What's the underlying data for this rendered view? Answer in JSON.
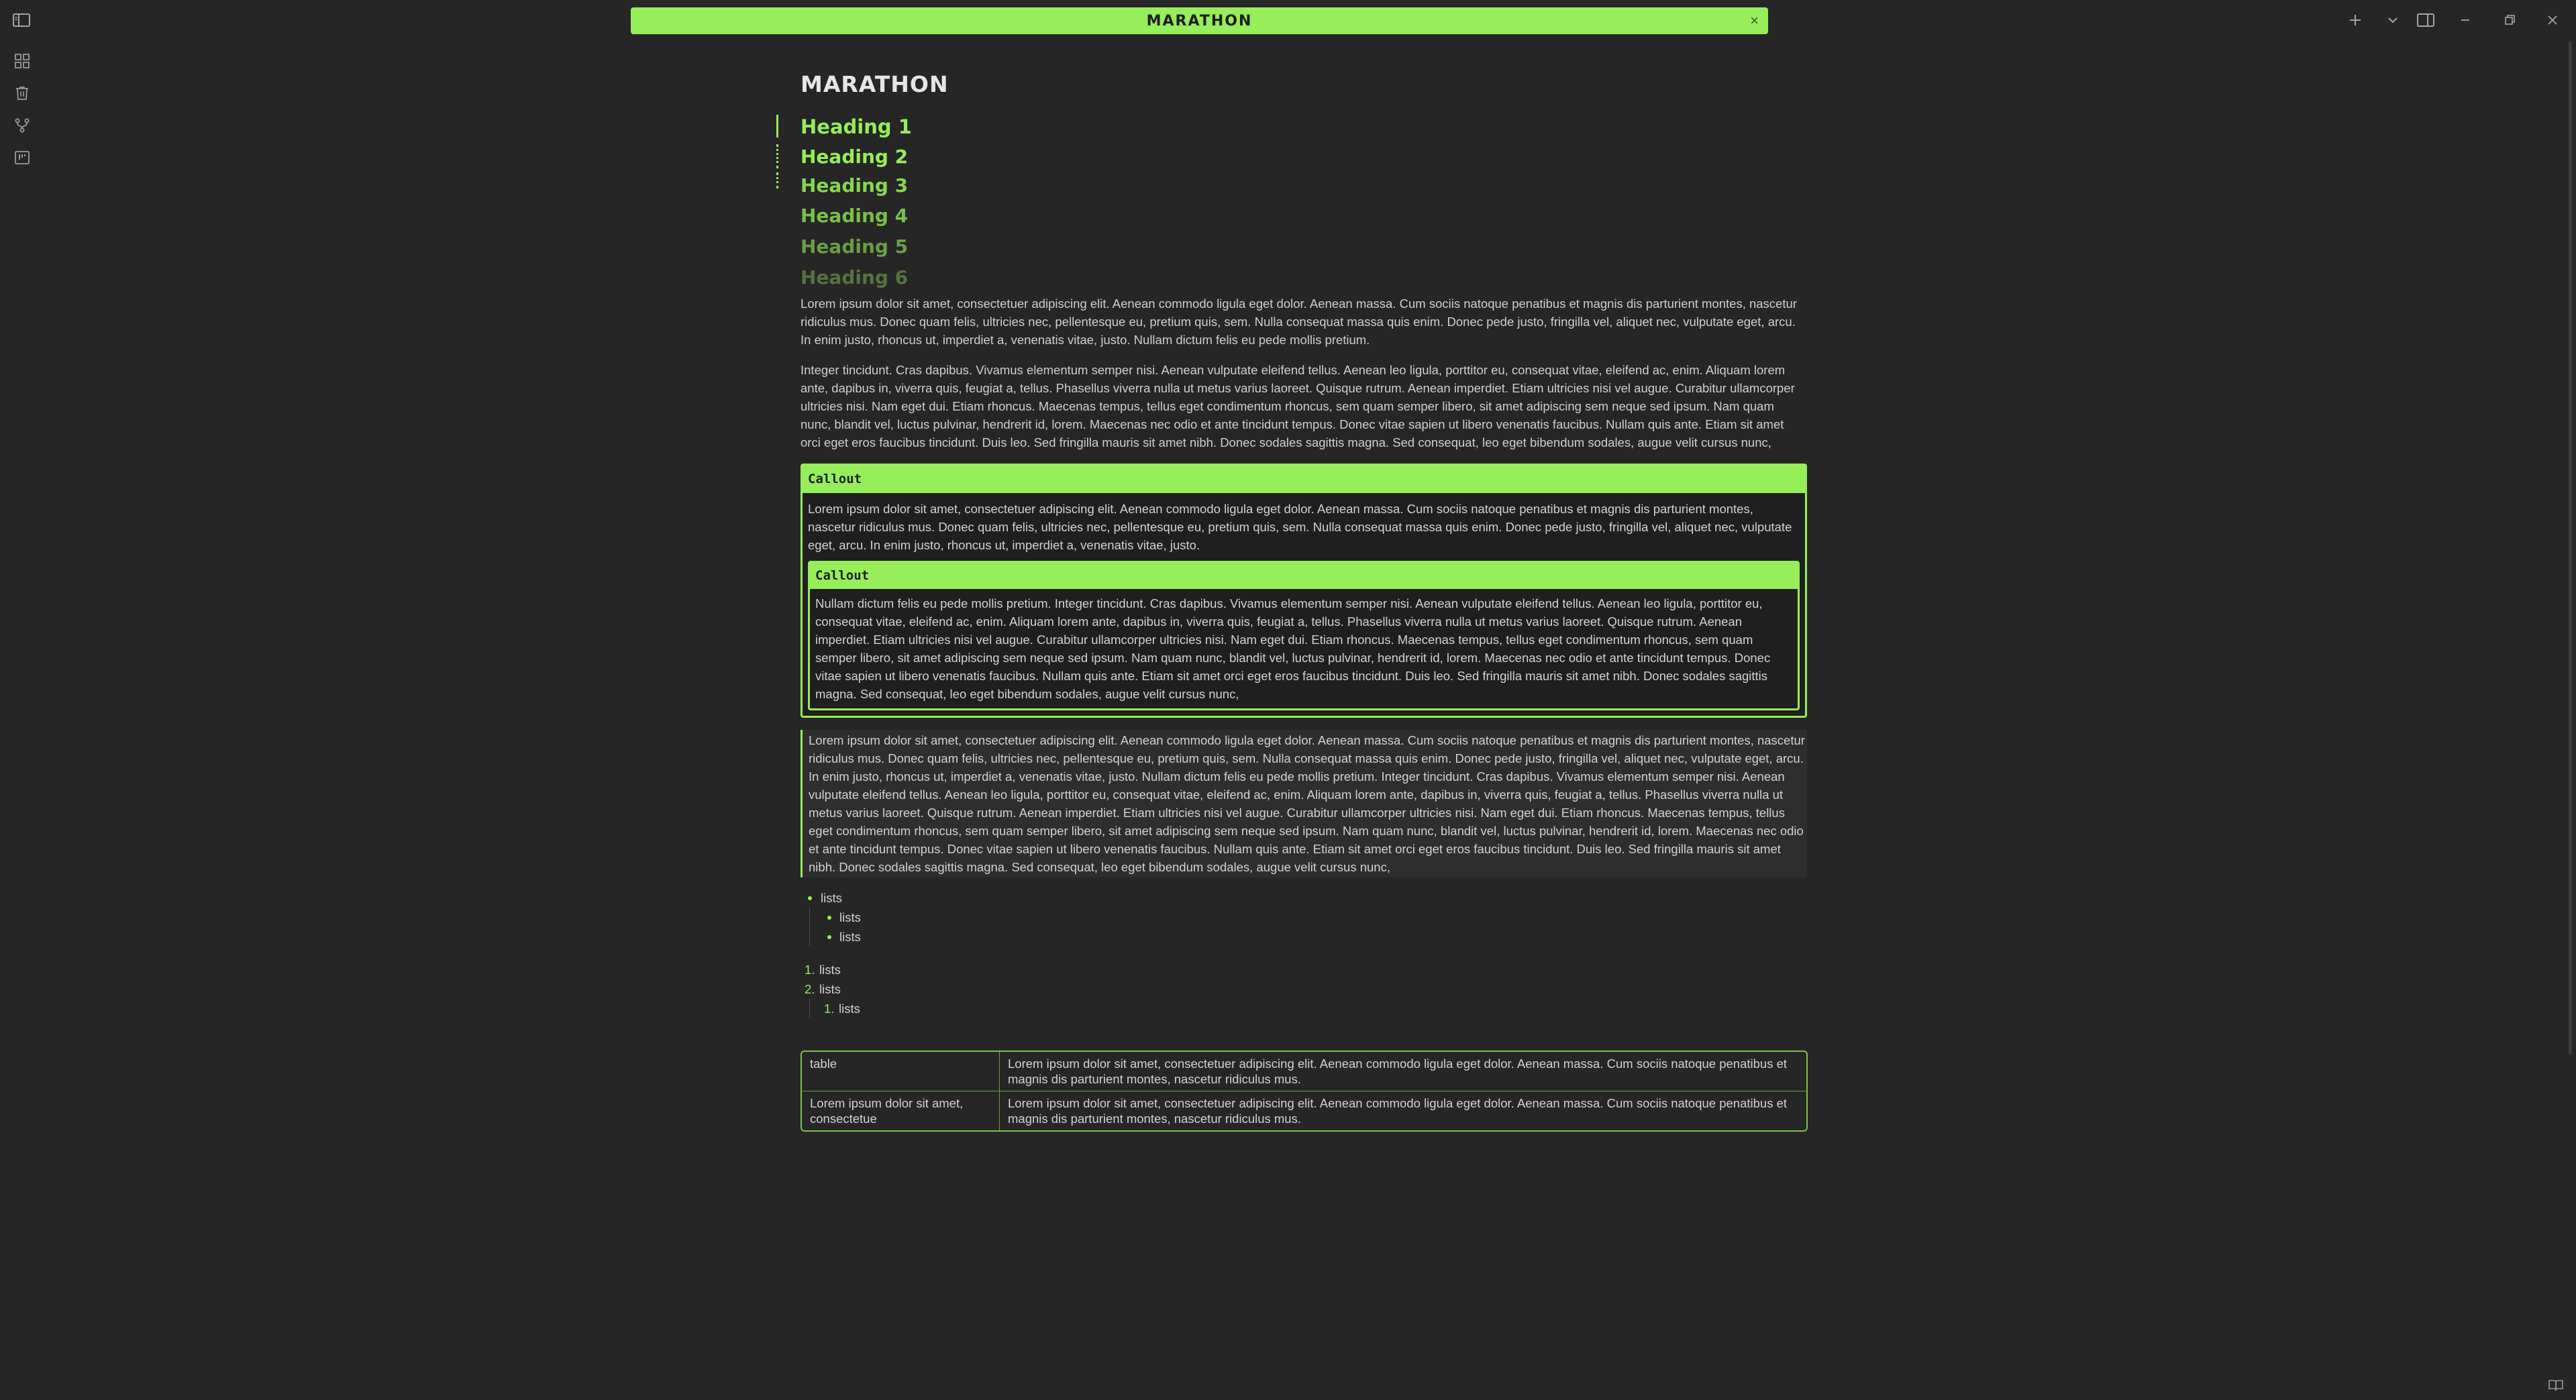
{
  "window": {
    "tab_title": "MARATHON",
    "tab_close": "×"
  },
  "icons": {
    "sidebar_toggle": "sidebar-toggle-icon",
    "ribbon": [
      "graph-icon",
      "trash-icon",
      "branch-icon",
      "kanban-icon"
    ],
    "new_tab": "plus-icon",
    "tab_list": "chevron-down-icon",
    "right_sidebar": "right-sidebar-icon",
    "minimize": "minimize-icon",
    "restore": "restore-icon",
    "close": "close-icon",
    "help": "book-icon"
  },
  "colors": {
    "accent": "#95ee5a",
    "background": "#262626",
    "text": "#cfcfcf"
  },
  "document": {
    "title": "MARATHON",
    "headings": [
      "Heading 1",
      "Heading 2",
      "Heading 3",
      "Heading 4",
      "Heading 5",
      "Heading 6"
    ],
    "paragraph1": "Lorem ipsum dolor sit amet, consectetuer adipiscing elit. Aenean commodo ligula eget dolor. Aenean massa. Cum sociis natoque penatibus et magnis dis parturient montes, nascetur ridiculus mus. Donec quam felis, ultricies nec, pellentesque eu, pretium quis, sem. Nulla consequat massa quis enim. Donec pede justo, fringilla vel, aliquet nec, vulputate eget, arcu. In enim justo, rhoncus ut, imperdiet a, venenatis vitae, justo. Nullam dictum felis eu pede mollis pretium.",
    "paragraph2": "Integer tincidunt. Cras dapibus. Vivamus elementum semper nisi. Aenean vulputate eleifend tellus. Aenean leo ligula, porttitor eu, consequat vitae, eleifend ac, enim. Aliquam lorem ante, dapibus in, viverra quis, feugiat a, tellus. Phasellus viverra nulla ut metus varius laoreet. Quisque rutrum. Aenean imperdiet. Etiam ultricies nisi vel augue. Curabitur ullamcorper ultricies nisi. Nam eget dui. Etiam rhoncus. Maecenas tempus, tellus eget condimentum rhoncus, sem quam semper libero, sit amet adipiscing sem neque sed ipsum. Nam quam nunc, blandit vel, luctus pulvinar, hendrerit id, lorem. Maecenas nec odio et ante tincidunt tempus. Donec vitae sapien ut libero venenatis faucibus. Nullam quis ante. Etiam sit amet orci eget eros faucibus tincidunt. Duis leo. Sed fringilla mauris sit amet nibh. Donec sodales sagittis magna. Sed consequat, leo eget bibendum sodales, augue velit cursus nunc,",
    "callout": {
      "title": "Callout",
      "body": "Lorem ipsum dolor sit amet, consectetuer adipiscing elit. Aenean commodo ligula eget dolor. Aenean massa. Cum sociis natoque penatibus et magnis dis parturient montes, nascetur ridiculus mus. Donec quam felis, ultricies nec, pellentesque eu, pretium quis, sem. Nulla consequat massa quis enim. Donec pede justo, fringilla vel, aliquet nec, vulputate eget, arcu. In enim justo, rhoncus ut, imperdiet a, venenatis vitae, justo.",
      "inner": {
        "title": "Callout",
        "body": "Nullam dictum felis eu pede mollis pretium. Integer tincidunt. Cras dapibus. Vivamus elementum semper nisi. Aenean vulputate eleifend tellus. Aenean leo ligula, porttitor eu, consequat vitae, eleifend ac, enim. Aliquam lorem ante, dapibus in, viverra quis, feugiat a, tellus. Phasellus viverra nulla ut metus varius laoreet. Quisque rutrum. Aenean imperdiet. Etiam ultricies nisi vel augue. Curabitur ullamcorper ultricies nisi. Nam eget dui. Etiam rhoncus. Maecenas tempus, tellus eget condimentum rhoncus, sem quam semper libero, sit amet adipiscing sem neque sed ipsum. Nam quam nunc, blandit vel, luctus pulvinar, hendrerit id, lorem. Maecenas nec odio et ante tincidunt tempus. Donec vitae sapien ut libero venenatis faucibus. Nullam quis ante. Etiam sit amet orci eget eros faucibus tincidunt. Duis leo. Sed fringilla mauris sit amet nibh. Donec sodales sagittis magna. Sed consequat, leo eget bibendum sodales, augue velit cursus nunc,"
      }
    },
    "quote": "Lorem ipsum dolor sit amet, consectetuer adipiscing elit. Aenean commodo ligula eget dolor. Aenean massa. Cum sociis natoque penatibus et magnis dis parturient montes, nascetur ridiculus mus. Donec quam felis, ultricies nec, pellentesque eu, pretium quis, sem. Nulla consequat massa quis enim. Donec pede justo, fringilla vel, aliquet nec, vulputate eget, arcu. In enim justo, rhoncus ut, imperdiet a, venenatis vitae, justo. Nullam dictum felis eu pede mollis pretium. Integer tincidunt. Cras dapibus. Vivamus elementum semper nisi. Aenean vulputate eleifend tellus. Aenean leo ligula, porttitor eu, consequat vitae, eleifend ac, enim. Aliquam lorem ante, dapibus in, viverra quis, feugiat a, tellus. Phasellus viverra nulla ut metus varius laoreet. Quisque rutrum. Aenean imperdiet. Etiam ultricies nisi vel augue. Curabitur ullamcorper ultricies nisi. Nam eget dui. Etiam rhoncus. Maecenas tempus, tellus eget condimentum rhoncus, sem quam semper libero, sit amet adipiscing sem neque sed ipsum. Nam quam nunc, blandit vel, luctus pulvinar, hendrerit id, lorem. Maecenas nec odio et ante tincidunt tempus. Donec vitae sapien ut libero venenatis faucibus. Nullam quis ante. Etiam sit amet orci eget eros faucibus tincidunt. Duis leo. Sed fringilla mauris sit amet nibh. Donec sodales sagittis magna. Sed consequat, leo eget bibendum sodales, augue velit cursus nunc,",
    "bullets": [
      "lists",
      "lists",
      "lists"
    ],
    "numbered": {
      "markers": [
        "1.",
        "2.",
        "1."
      ],
      "items": [
        "lists",
        "lists",
        "lists"
      ]
    },
    "table": {
      "rows": [
        [
          "table",
          "Lorem ipsum dolor sit amet, consectetuer adipiscing elit. Aenean commodo ligula eget dolor. Aenean massa. Cum sociis natoque penatibus et magnis dis parturient montes, nascetur ridiculus mus."
        ],
        [
          "Lorem ipsum dolor sit amet, consectetue",
          "Lorem ipsum dolor sit amet, consectetuer adipiscing elit. Aenean commodo ligula eget dolor. Aenean massa. Cum sociis natoque penatibus et magnis dis parturient montes, nascetur ridiculus mus."
        ]
      ]
    }
  }
}
